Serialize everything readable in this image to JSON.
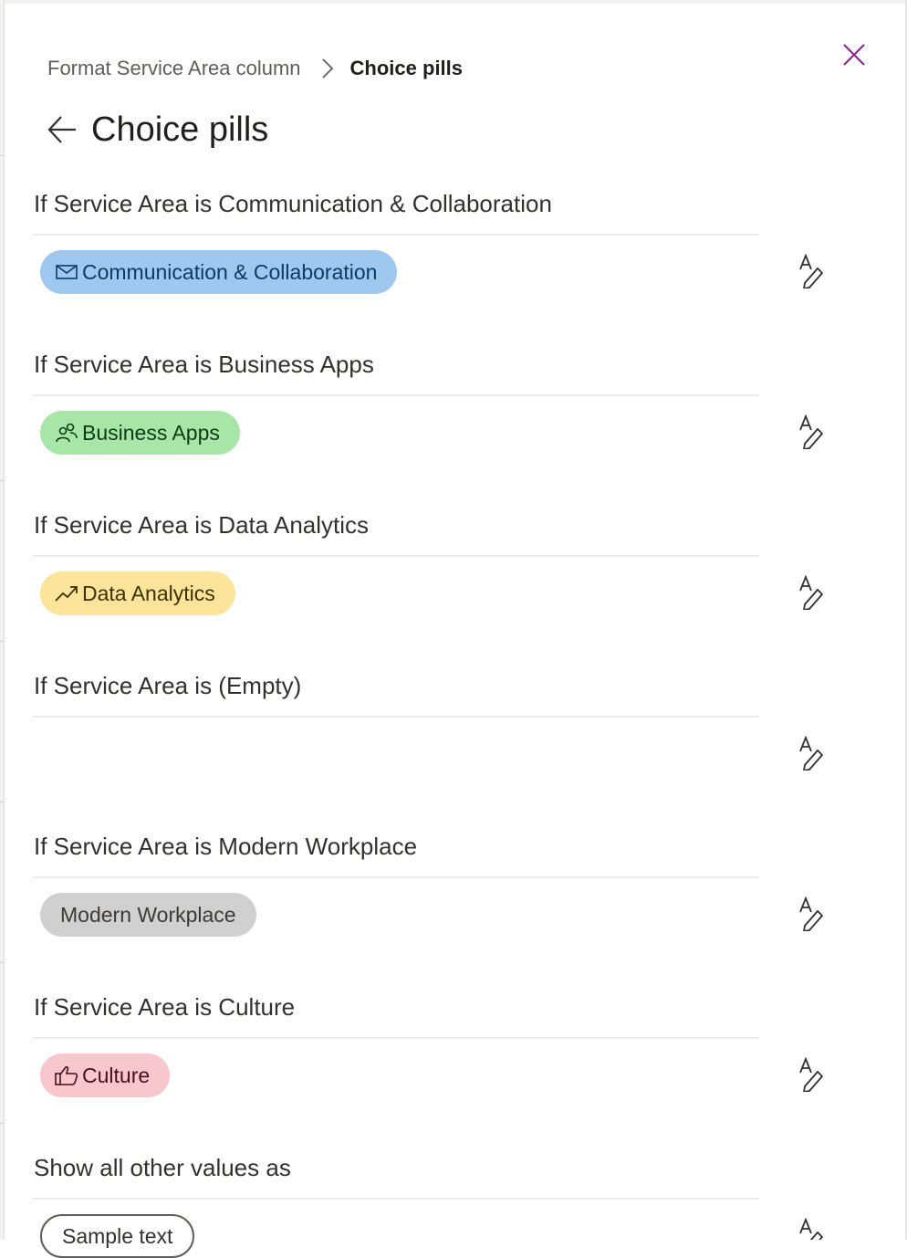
{
  "breadcrumb": {
    "parent": "Format Service Area column",
    "current": "Choice pills"
  },
  "page": {
    "title": "Choice pills"
  },
  "rules": [
    {
      "label": "If Service Area is Communication & Collaboration",
      "pill": "Communication & Collaboration",
      "icon": "mail-icon",
      "bg": "#9ec8ef"
    },
    {
      "label": "If Service Area is Business Apps",
      "pill": "Business Apps",
      "icon": "people-icon",
      "bg": "#a8e6a8"
    },
    {
      "label": "If Service Area is Data Analytics",
      "pill": "Data Analytics",
      "icon": "trending-up-icon",
      "bg": "#fce49a"
    },
    {
      "label": "If Service Area is (Empty)",
      "pill": "",
      "icon": "",
      "bg": ""
    },
    {
      "label": "If Service Area is Modern Workplace",
      "pill": "Modern Workplace",
      "icon": "",
      "bg": "#d0d0d0"
    },
    {
      "label": "If Service Area is Culture",
      "pill": "Culture",
      "icon": "thumbs-up-icon",
      "bg": "#f8c6cd"
    },
    {
      "label": "Show all other values as",
      "pill": "Sample text",
      "icon": "",
      "bg": "#ffffff"
    }
  ],
  "colors": {
    "accent": "#8a2a8a",
    "divider": "#edebe9"
  }
}
